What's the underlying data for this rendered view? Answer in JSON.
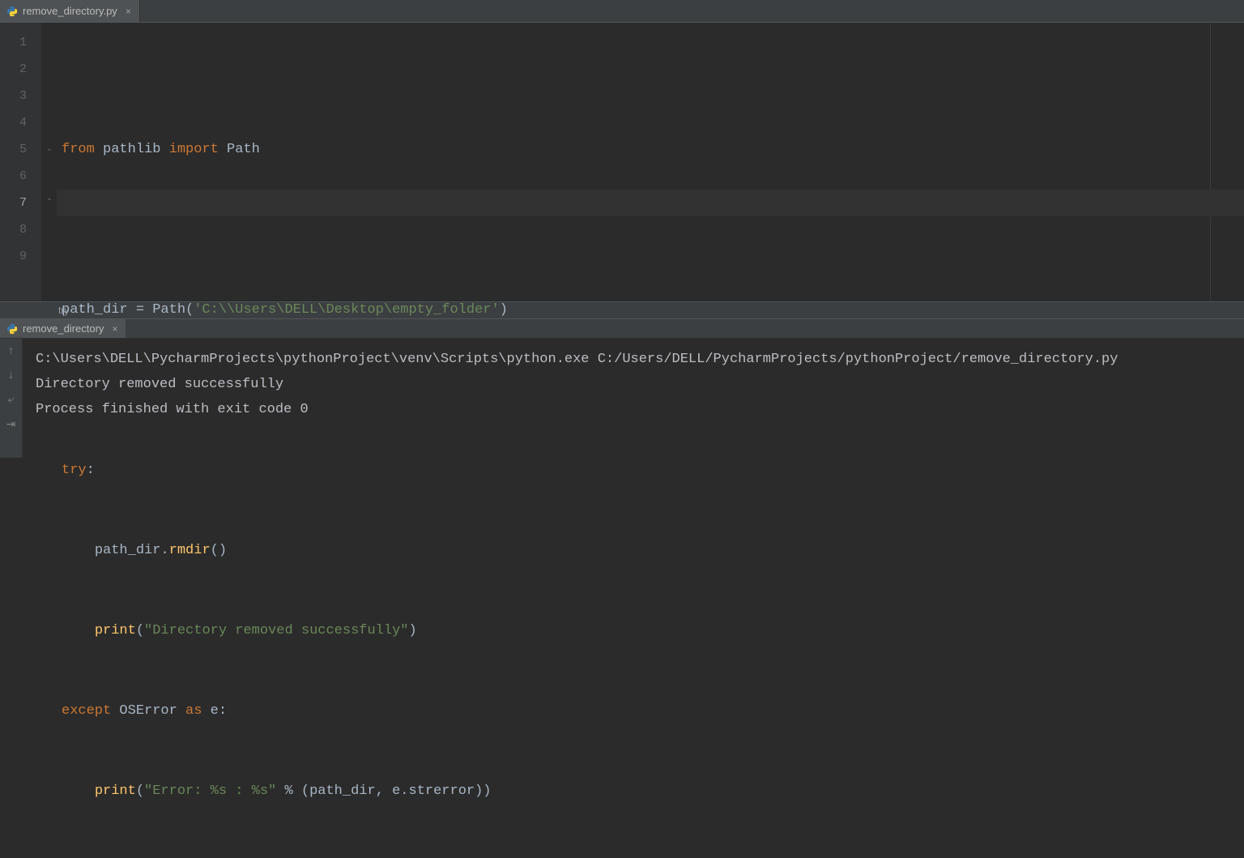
{
  "editor": {
    "tab": {
      "filename": "remove_directory.py"
    },
    "active_line": 7,
    "lines": [
      1,
      2,
      3,
      4,
      5,
      6,
      7,
      8,
      9
    ],
    "code": {
      "l1": {
        "kw1": "from",
        "mod": " pathlib ",
        "kw2": "import",
        "cls": " Path"
      },
      "l3": {
        "lhs": "path_dir = Path(",
        "str": "'C:\\\\Users\\DELL\\Desktop\\empty_folder'",
        "rhs": ")"
      },
      "l5": {
        "kw": "try",
        "colon": ":"
      },
      "l6": {
        "indent": "    ",
        "obj": "path_dir.",
        "fn": "rmdir",
        "paren": "()"
      },
      "l7": {
        "indent": "    ",
        "fn": "print",
        "open": "(",
        "str": "\"Directory removed successfully\"",
        "close": ")"
      },
      "l8": {
        "kw1": "except ",
        "cls": "OSError",
        "kw2": " as ",
        "var": "e",
        "colon": ":"
      },
      "l9": {
        "indent": "    ",
        "fn": "print",
        "open": "(",
        "str": "\"Error: %s : %s\"",
        "mid": " % (path_dir",
        "comma": ", ",
        "attr": "e.strerror))"
      }
    },
    "breadcrumb": "try"
  },
  "run": {
    "tab": "remove_directory",
    "output": {
      "cmd": "C:\\Users\\DELL\\PycharmProjects\\pythonProject\\venv\\Scripts\\python.exe C:/Users/DELL/PycharmProjects/pythonProject/remove_directory.py",
      "line1": "Directory removed successfully",
      "blank": "",
      "exit": "Process finished with exit code 0"
    }
  },
  "icons": {
    "close": "×",
    "up": "↑",
    "down": "↓",
    "wrap": "⤶",
    "export": "⇥"
  }
}
